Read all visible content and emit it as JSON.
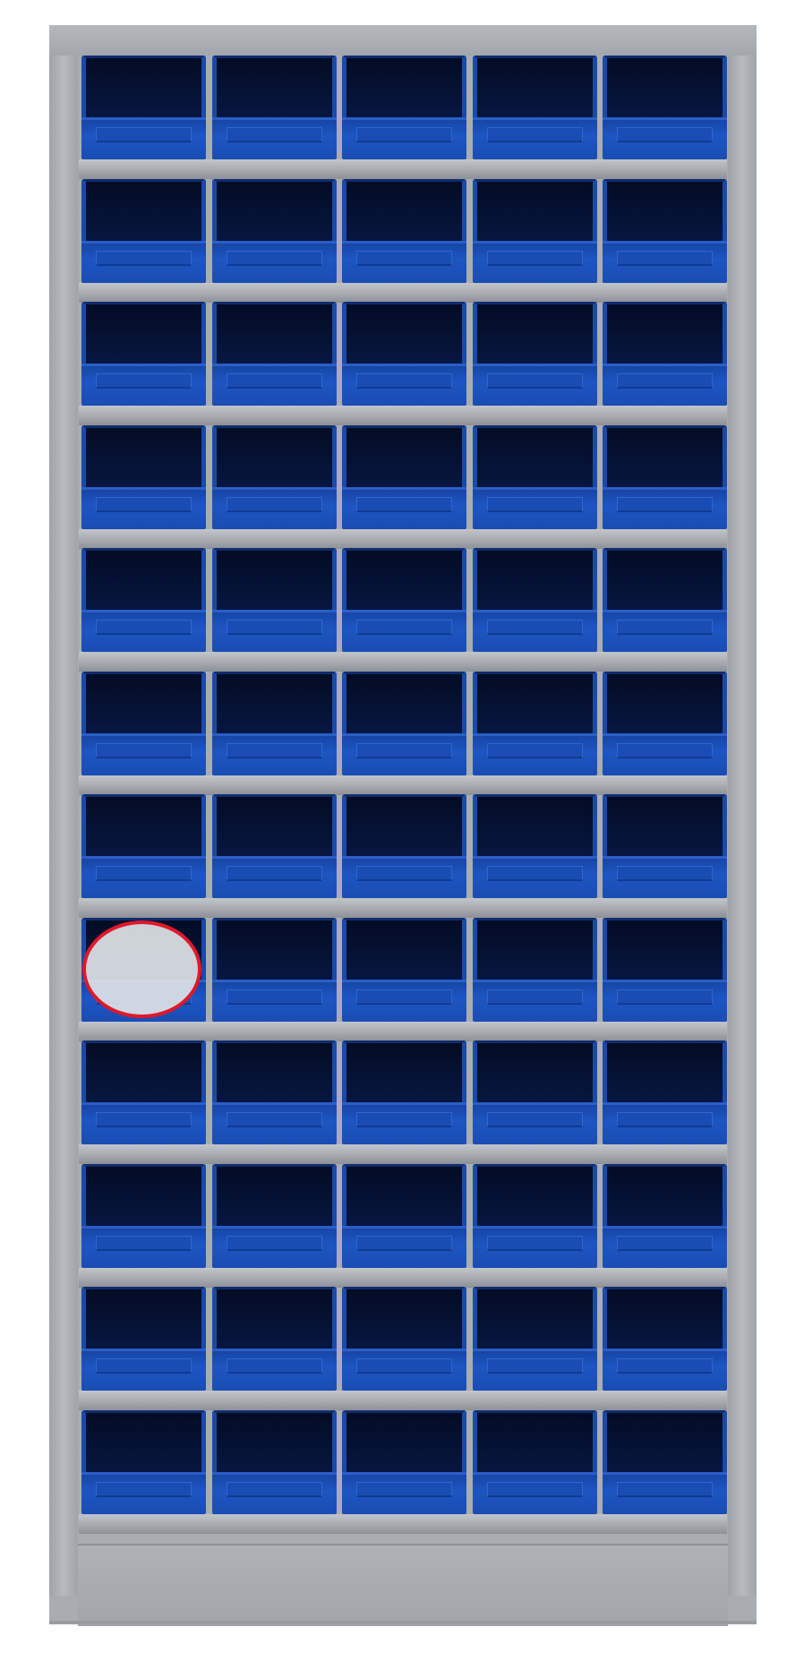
{
  "image": {
    "subject": "storage-cabinet",
    "frame_color": "#a9adb3",
    "bin_color": "#1d55c2",
    "bin_interior_color": "#07163f",
    "highlight_color": "#e0182a"
  },
  "grid": {
    "columns": 5,
    "rows": 12
  },
  "highlight": {
    "row": 8,
    "column": 1,
    "shape": "ellipse",
    "fill": "#dee1e6"
  }
}
